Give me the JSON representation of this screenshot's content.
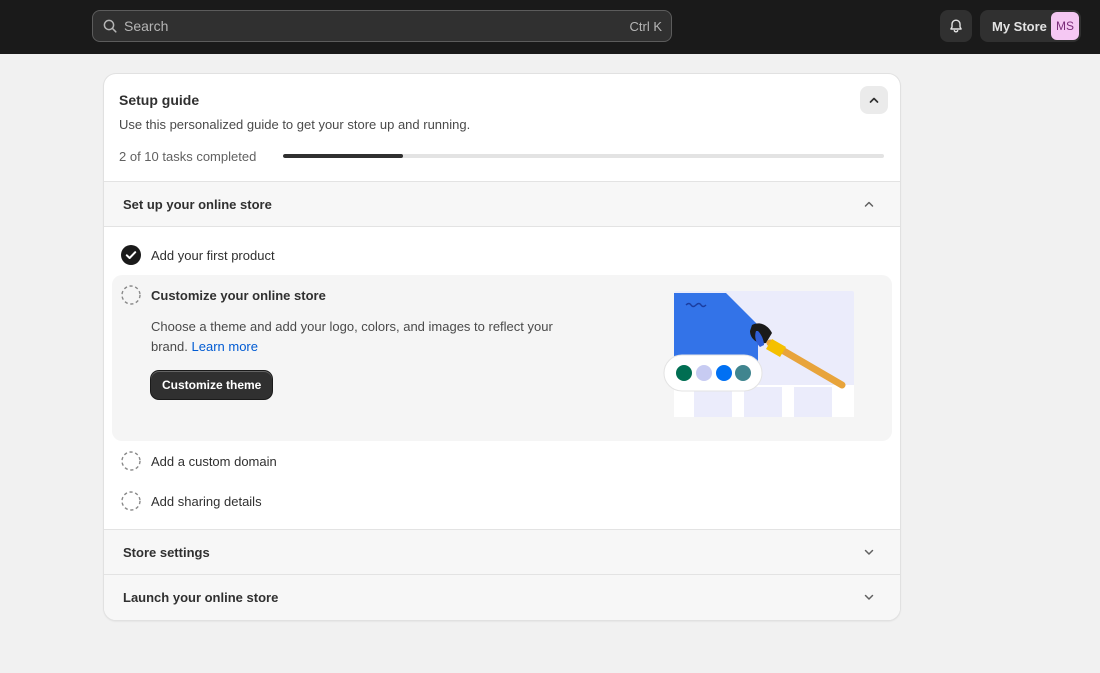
{
  "topbar": {
    "search": {
      "placeholder": "Search",
      "shortcut": "Ctrl K"
    },
    "icons": {
      "search": "search-icon",
      "notifications": "bell-icon"
    },
    "store": {
      "name": "My Store",
      "initials": "MS"
    }
  },
  "setup_guide": {
    "title": "Setup guide",
    "subtitle": "Use this personalized guide to get your store up and running.",
    "progress": {
      "text": "2 of 10 tasks completed",
      "completed": 2,
      "total": 10
    },
    "sections": [
      {
        "label": "Set up your online store",
        "expanded": true,
        "tasks": [
          {
            "label": "Add your first product",
            "done": true
          },
          {
            "label": "Customize your online store",
            "done": false,
            "active": true,
            "description": "Choose a theme and add your logo, colors, and images to reflect your brand.",
            "link": "Learn more",
            "button": "Customize theme",
            "illustration": "theme-paintbrush-illustration",
            "swatch_colors": [
              "#006e52",
              "#c7cbf2",
              "#0070f3",
              "#40858f"
            ]
          },
          {
            "label": "Add a custom domain",
            "done": false
          },
          {
            "label": "Add sharing details",
            "done": false
          }
        ]
      },
      {
        "label": "Store settings",
        "expanded": false
      },
      {
        "label": "Launch your online store",
        "expanded": false
      }
    ]
  },
  "colors": {
    "topbar": "#1a1a1a",
    "page": "#f1f1f1",
    "primary_button": "#303030",
    "link": "#005bd3"
  }
}
